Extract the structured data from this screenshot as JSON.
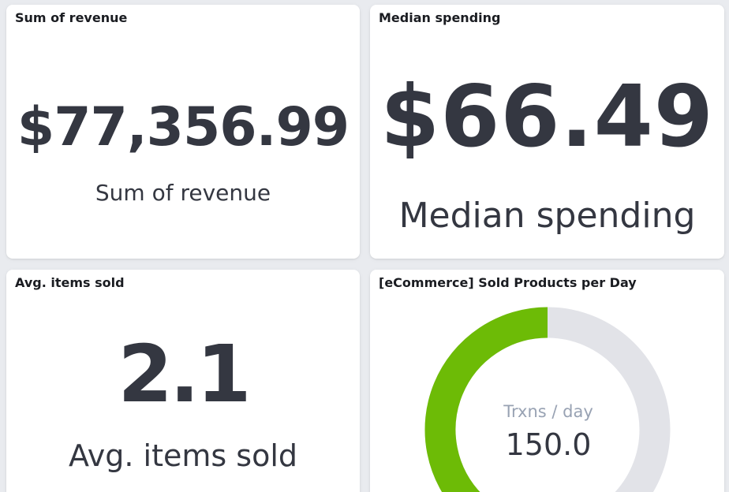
{
  "panels": {
    "revenue": {
      "title": "Sum of revenue",
      "value": "$77,356.99",
      "label": "Sum of revenue"
    },
    "median": {
      "title": "Median spending",
      "value": "$66.49",
      "label": "Median spending"
    },
    "items": {
      "title": "Avg. items sold",
      "value": "2.1",
      "label": "Avg. items sold"
    },
    "gauge": {
      "title": "[eCommerce] Sold Products per Day",
      "sublabel": "Trxns / day",
      "value_text": "150.0",
      "value": 150,
      "min": 0,
      "max": 300,
      "fill_color": "#6dbb06",
      "track_color": "#e2e3e8"
    }
  }
}
